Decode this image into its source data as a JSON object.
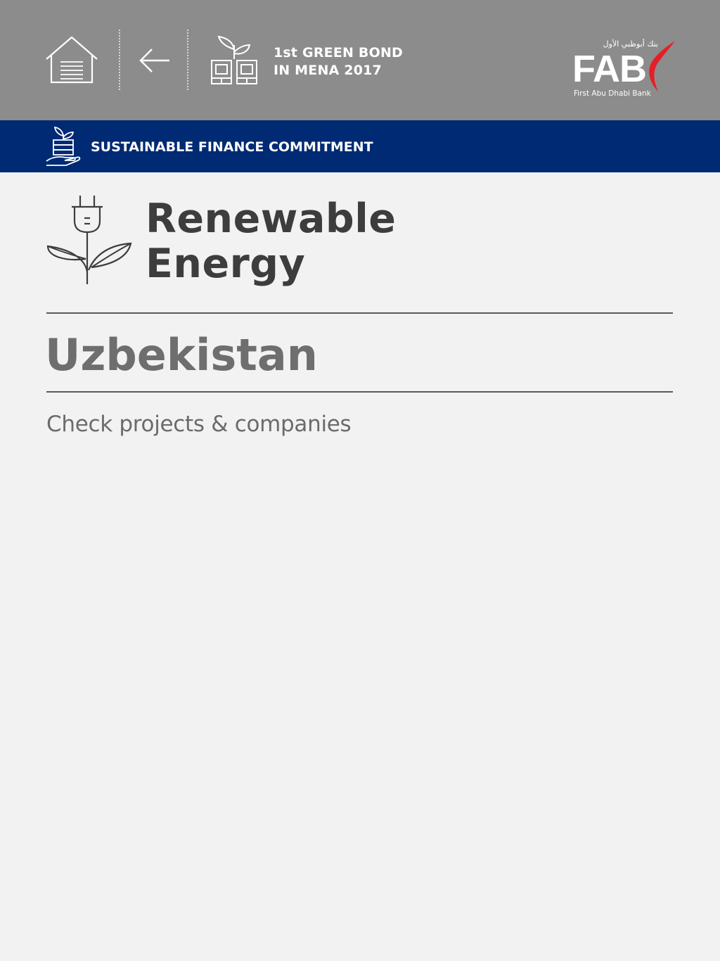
{
  "header": {
    "home_icon": "home-icon",
    "back_icon": "arrow-left-icon",
    "bond_icon": "plant-money-icon",
    "bond_line1": "1st GREEN BOND",
    "bond_line2": "IN MENA 2017",
    "logo": {
      "arabic": "بنك أبوظبي الأول",
      "word": "FAB",
      "subtitle": "First Abu Dhabi Bank",
      "swoosh_color": "#e41f26"
    },
    "background_color": "#8c8c8c"
  },
  "banner": {
    "icon": "hand-plant-money-icon",
    "label": "SUSTAINABLE FINANCE COMMITMENT",
    "background_color": "#002a73"
  },
  "category": {
    "icon": "plug-plant-icon",
    "title_line1": "Renewable",
    "title_line2": "Energy"
  },
  "country": "Uzbekistan",
  "projects_link_label": "Check projects & companies"
}
